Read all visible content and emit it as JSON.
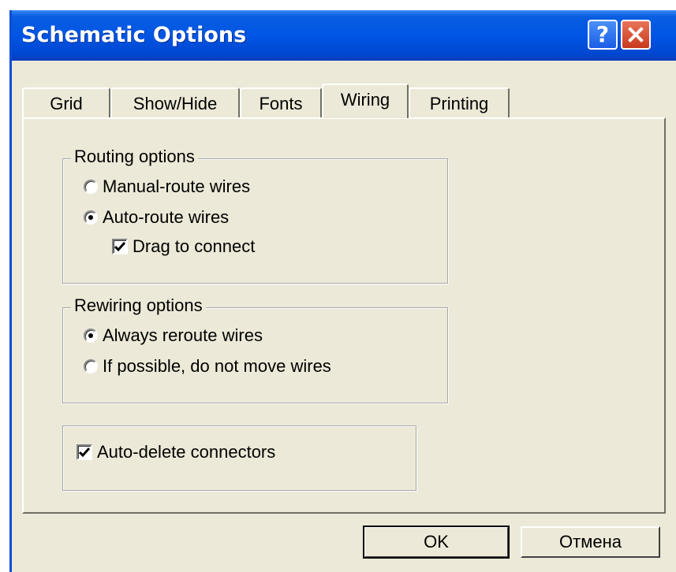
{
  "window": {
    "title": "Schematic Options",
    "help_icon": "?",
    "colors": {
      "titlebar": "#0055e5",
      "close": "#c8391d",
      "face": "#ece9d8"
    }
  },
  "tabs": [
    {
      "label": "Grid",
      "active": false
    },
    {
      "label": "Show/Hide",
      "active": false
    },
    {
      "label": "Fonts",
      "active": false
    },
    {
      "label": "Wiring",
      "active": true
    },
    {
      "label": "Printing",
      "active": false
    }
  ],
  "routing": {
    "legend": "Routing options",
    "manual": {
      "label": "Manual-route wires",
      "selected": false
    },
    "auto": {
      "label": "Auto-route wires",
      "selected": true
    },
    "drag": {
      "label": "Drag to connect",
      "checked": true
    }
  },
  "rewiring": {
    "legend": "Rewiring options",
    "always": {
      "label": "Always reroute wires",
      "selected": true
    },
    "possible": {
      "label": "If possible, do not move wires",
      "selected": false
    }
  },
  "autodelete": {
    "label": "Auto-delete connectors",
    "checked": true
  },
  "buttons": {
    "ok": "OK",
    "cancel": "Отмена"
  }
}
